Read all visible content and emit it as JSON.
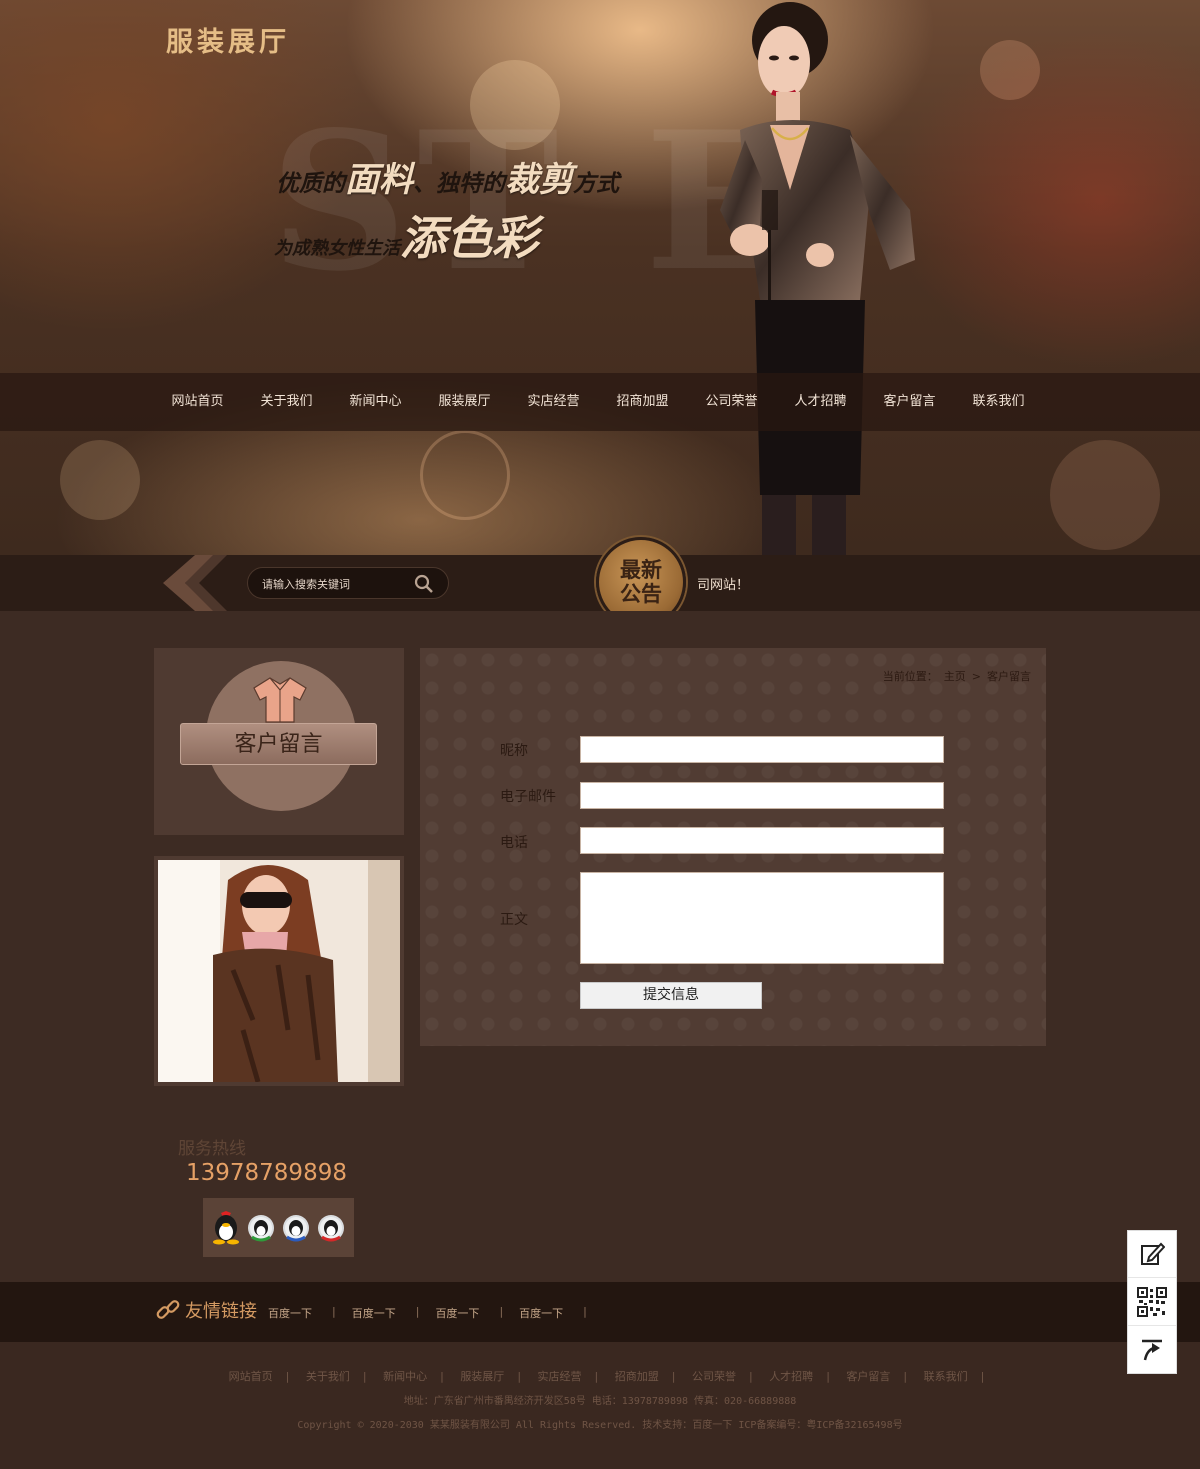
{
  "brand": {
    "logo_text": "服装展厅"
  },
  "hero": {
    "slogan_line1": {
      "a": "优质的",
      "b": "面料",
      "c": "、独特的",
      "d": "裁剪",
      "e": "方式"
    },
    "slogan_line2": {
      "a": "为成熟女性生活",
      "b": "添色彩"
    }
  },
  "nav": {
    "items": [
      "网站首页",
      "关于我们",
      "新闻中心",
      "服装展厅",
      "实店经营",
      "招商加盟",
      "公司荣誉",
      "人才招聘",
      "客户留言",
      "联系我们"
    ]
  },
  "search": {
    "placeholder": "请输入搜索关键词",
    "icon": "search-icon"
  },
  "notice": {
    "badge_line1": "最新",
    "badge_line2": "公告",
    "text": "司网站！"
  },
  "sidebar": {
    "section_title": "客户留言",
    "hotline_label": "服务热线",
    "hotline_number": "13978789898"
  },
  "breadcrumb": {
    "prefix": "当前位置：",
    "home": "主页",
    "separator": ">",
    "current": "客户留言"
  },
  "form": {
    "nickname_label": "昵称",
    "email_label": "电子邮件",
    "phone_label": "电话",
    "body_label": "正文",
    "nickname_value": "",
    "email_value": "",
    "phone_value": "",
    "body_value": "",
    "submit_label": "提交信息"
  },
  "friend_links": {
    "title": "友情链接",
    "items": [
      "百度一下",
      "百度一下",
      "百度一下",
      "百度一下"
    ],
    "separator": "|"
  },
  "footer": {
    "nav": [
      "网站首页",
      "关于我们",
      "新闻中心",
      "服装展厅",
      "实店经营",
      "招商加盟",
      "公司荣誉",
      "人才招聘",
      "客户留言",
      "联系我们"
    ],
    "separator": "|",
    "address_line": "地址：广东省广州市番禺经济开发区58号    电话：13978789898    传真：020-66889888",
    "copyright_line": "Copyright © 2020-2030 某某服装有限公司 All Rights Reserved.    技术支持：百度一下    ICP备案编号：粤ICP备32165498号"
  },
  "float_toolbar": {
    "icons": [
      "edit-icon",
      "qrcode-icon",
      "back-to-top-icon"
    ]
  },
  "colors": {
    "accent": "#e6a166",
    "nav_bg": "#281810",
    "footer_bg": "#3a2820"
  }
}
